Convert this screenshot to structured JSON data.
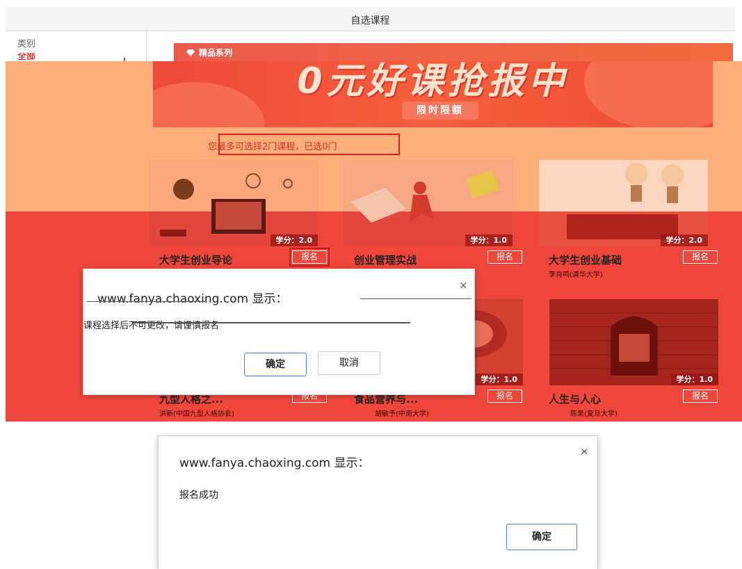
{
  "page": {
    "title": "自选课程",
    "sidebar": {
      "category_label": "类别",
      "all_label": "全部"
    }
  },
  "banner": {
    "series_label": "精品系列",
    "headline": "0元好课抢报中",
    "subline": "限时限额"
  },
  "notice": "您最多可选择2门课程，已选0门",
  "courses": [
    {
      "name": "大学生创业导论",
      "teacher": "",
      "credit": "学分：2.0",
      "enroll_label": "报名",
      "image": "business-idea-illustration"
    },
    {
      "name": "创业管理实战",
      "teacher": "",
      "credit": "学分：1.0",
      "enroll_label": "报名",
      "image": "runner-creativity"
    },
    {
      "name": "大学生创业基础",
      "teacher": "李肖鸣(清华大学)",
      "credit": "学分：2.0",
      "enroll_label": "报名",
      "image": "lightbulbs-business"
    },
    {
      "name": "九型人格之...",
      "teacher": "洪新(中国九型人格协会)",
      "credit": "",
      "enroll_label": "报名",
      "image": ""
    },
    {
      "name": "食品营养与...",
      "teacher": "胡敏予(中南大学)",
      "credit": "学分：1.0",
      "enroll_label": "报名",
      "image": "food-plate"
    },
    {
      "name": "人生与人心",
      "teacher": "陈果(复旦大学)",
      "credit": "学分：1.0",
      "enroll_label": "报名",
      "image": "brick-doorway"
    }
  ],
  "confirm_dialog": {
    "origin": "www.fanya.chaoxing.com 显示：",
    "message": "课程选择后不可更改，请谨慎报名",
    "ok_label": "确定",
    "cancel_label": "取消",
    "close_glyph": "×"
  },
  "success_dialog": {
    "origin": "www.fanya.chaoxing.com 显示：",
    "message": "报名成功",
    "ok_label": "确定",
    "close_glyph": "×"
  },
  "colors": {
    "brand_red": "#f1463a",
    "faded_orange": "#fcae78",
    "highlight_box": "#e02020",
    "primary_button_border": "#4a7fd6"
  },
  "icons": [
    "gem-icon",
    "close-icon"
  ]
}
